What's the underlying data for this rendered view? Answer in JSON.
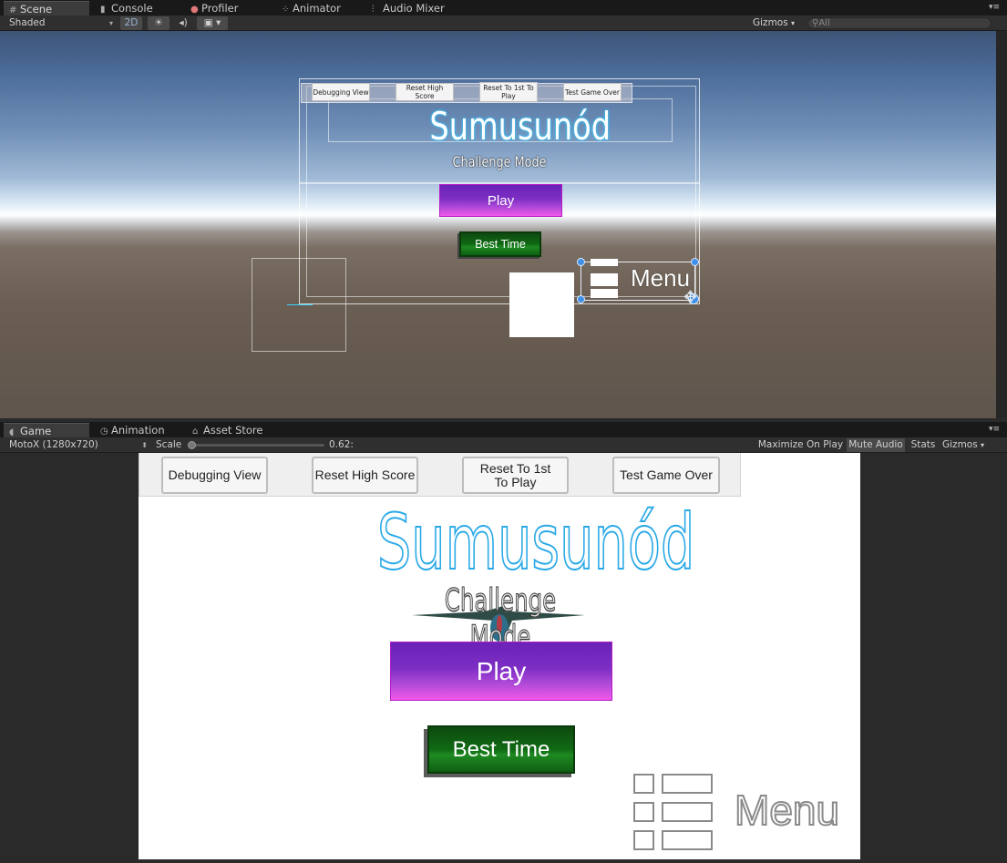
{
  "scene_panel": {
    "tabs": [
      {
        "label": "Scene",
        "icon": "grid-icon"
      },
      {
        "label": "Console",
        "icon": "console-icon"
      },
      {
        "label": "Profiler",
        "icon": "profiler-icon"
      },
      {
        "label": "Animator",
        "icon": "animator-icon"
      },
      {
        "label": "Audio Mixer",
        "icon": "mixer-icon"
      }
    ],
    "toolbar": {
      "shading_mode": "Shaded",
      "mode_2d": "2D",
      "gizmos_label": "Gizmos",
      "search_placeholder": "All"
    },
    "canvas": {
      "buttons": [
        "Debugging View",
        "Reset High Score",
        "Reset To 1st To Play",
        "Test Game Over"
      ],
      "title": "Sumusunód",
      "subtitle": "Challenge Mode",
      "play_label": "Play",
      "best_time_label": "Best Time",
      "menu_label": "Menu"
    }
  },
  "game_panel": {
    "tabs": [
      {
        "label": "Game",
        "icon": "game-icon"
      },
      {
        "label": "Animation",
        "icon": "animation-icon"
      },
      {
        "label": "Asset Store",
        "icon": "asset-store-icon"
      }
    ],
    "toolbar": {
      "resolution": "MotoX (1280x720)",
      "scale_label": "Scale",
      "scale_value": "0.62:",
      "scale_fraction": 0.0,
      "maximize_on_play": "Maximize On Play",
      "mute_audio": "Mute Audio",
      "stats": "Stats",
      "gizmos": "Gizmos"
    },
    "view": {
      "buttons": [
        "Debugging View",
        "Reset High Score",
        "Reset To 1st To Play",
        "Test Game Over"
      ],
      "title": "Sumusunód",
      "subtitle": "Challenge Mode",
      "play_label": "Play",
      "best_time_label": "Best Time",
      "menu_label": "Menu"
    }
  }
}
